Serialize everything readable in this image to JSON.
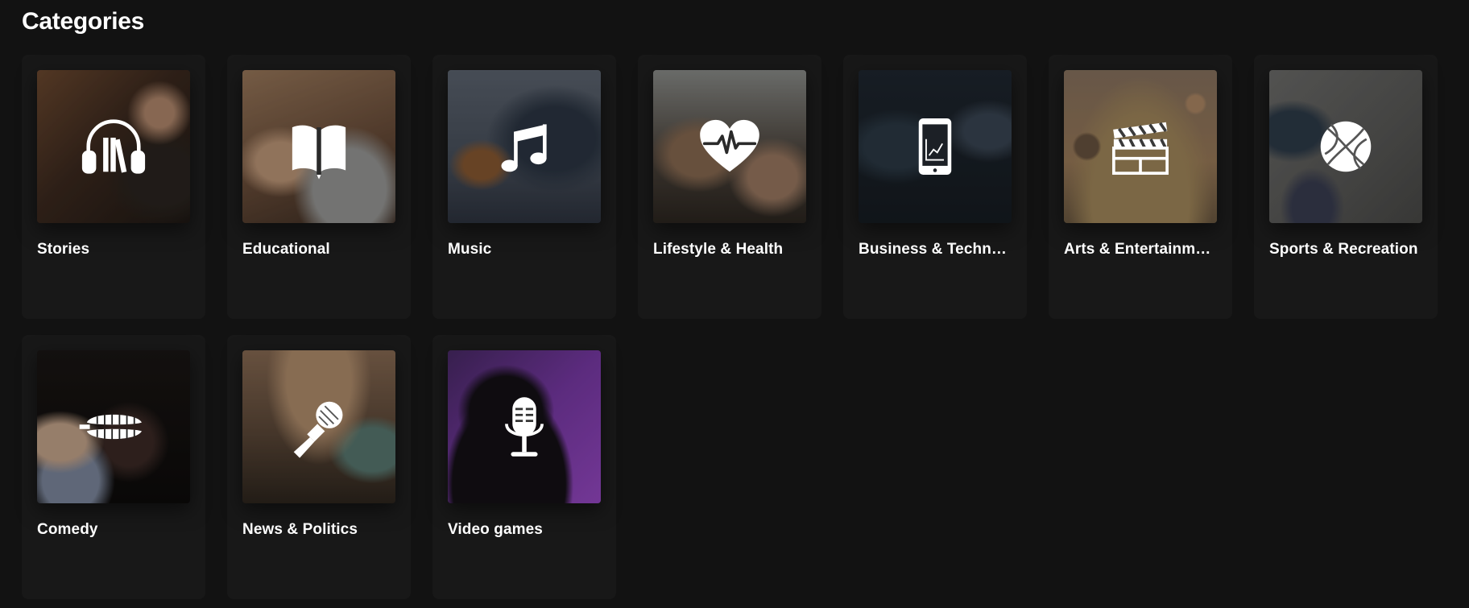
{
  "section": {
    "title": "Categories"
  },
  "categories": [
    {
      "label": "Stories",
      "icon": "headphones-books-icon"
    },
    {
      "label": "Educational",
      "icon": "open-book-icon"
    },
    {
      "label": "Music",
      "icon": "music-note-icon"
    },
    {
      "label": "Lifestyle & Health",
      "icon": "heart-pulse-icon"
    },
    {
      "label": "Business & Technol...",
      "icon": "tablet-chart-icon"
    },
    {
      "label": "Arts & Entertainment",
      "icon": "clapperboard-icon"
    },
    {
      "label": "Sports & Recreation",
      "icon": "basketball-icon"
    },
    {
      "label": "Comedy",
      "icon": "chattering-teeth-icon"
    },
    {
      "label": "News & Politics",
      "icon": "reporter-microphone-icon"
    },
    {
      "label": "Video games",
      "icon": "studio-microphone-icon"
    }
  ]
}
